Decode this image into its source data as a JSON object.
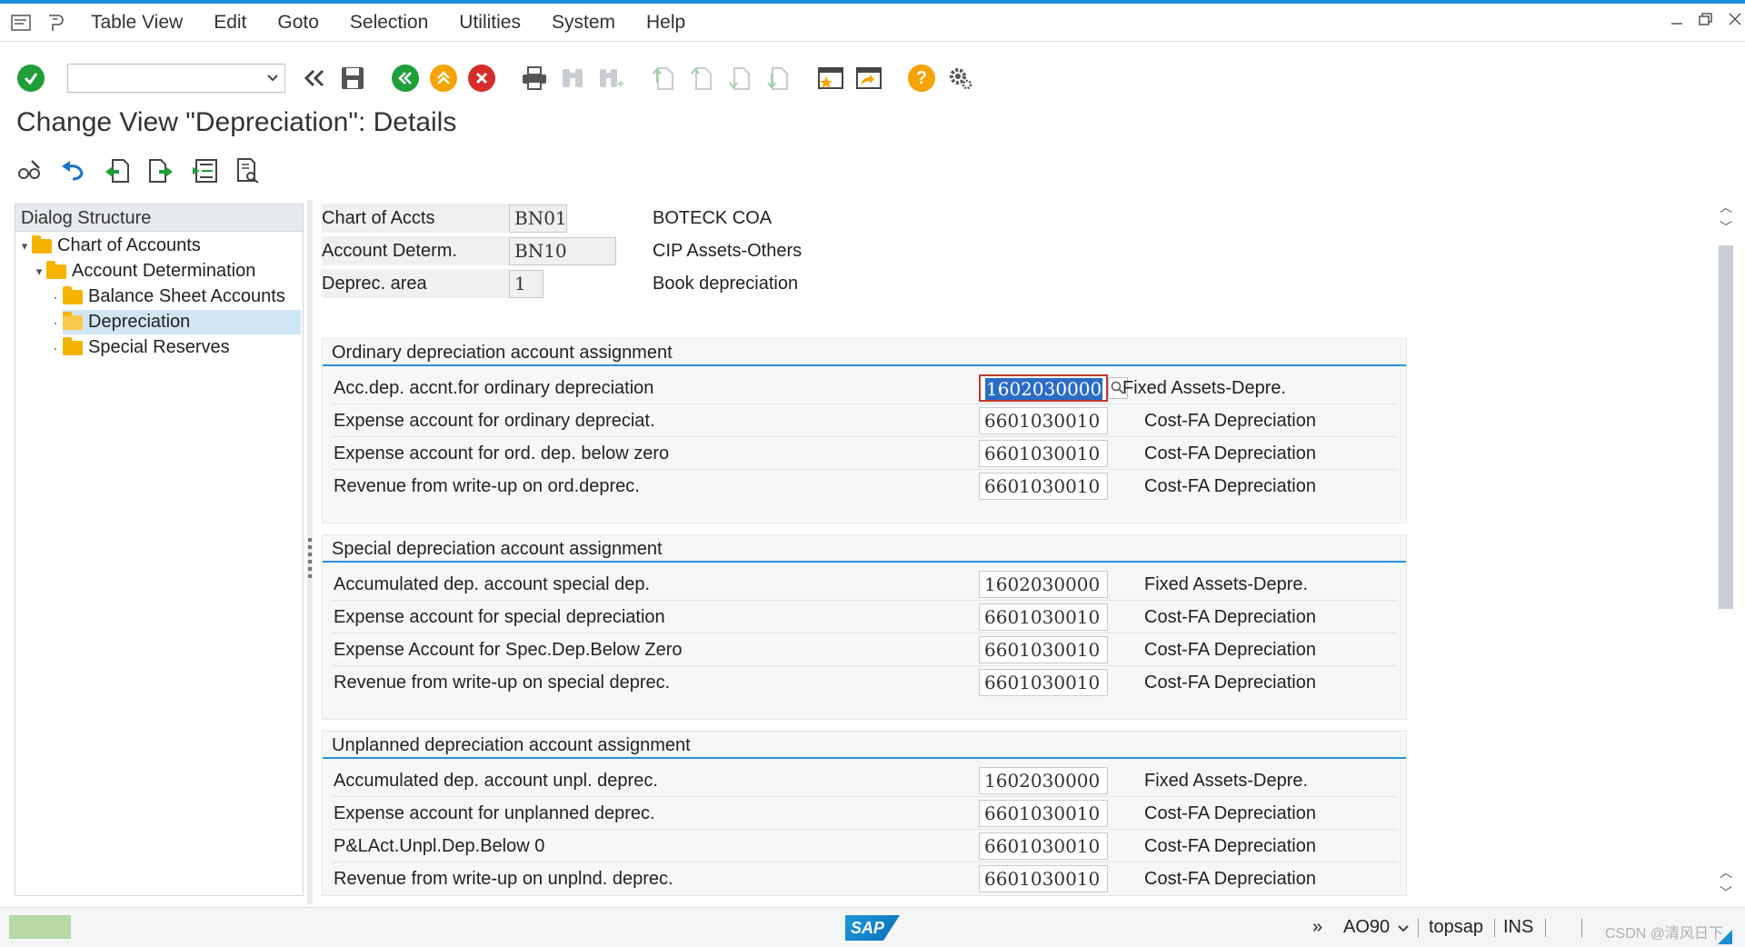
{
  "menu": {
    "items": [
      "Table View",
      "Edit",
      "Goto",
      "Selection",
      "Utilities",
      "System",
      "Help"
    ]
  },
  "toolbar": {
    "command_field_value": ""
  },
  "page_title": "Change View \"Depreciation\": Details",
  "dialog_structure": {
    "header": "Dialog Structure",
    "nodes": [
      {
        "label": "Chart of Accounts"
      },
      {
        "label": "Account Determination"
      },
      {
        "label": "Balance Sheet Accounts"
      },
      {
        "label": "Depreciation"
      },
      {
        "label": "Special Reserves"
      }
    ]
  },
  "header_fields": [
    {
      "label": "Chart of Accts",
      "value": "BN01",
      "desc": "BOTECK COA"
    },
    {
      "label": "Account Determ.",
      "value": "BN10",
      "desc": "CIP Assets-Others"
    },
    {
      "label": "Deprec. area",
      "value": "1",
      "desc": "Book depreciation"
    }
  ],
  "sections": [
    {
      "title": "Ordinary depreciation account assignment",
      "rows": [
        {
          "label": "Acc.dep. accnt.for ordinary depreciation",
          "value": "1602030000",
          "desc": "Fixed Assets-Depre."
        },
        {
          "label": "Expense account for ordinary depreciat.",
          "value": "6601030010",
          "desc": "Cost-FA Depreciation"
        },
        {
          "label": "Expense account for ord. dep. below zero",
          "value": "6601030010",
          "desc": "Cost-FA Depreciation"
        },
        {
          "label": "Revenue from write-up on ord.deprec.",
          "value": "6601030010",
          "desc": "Cost-FA Depreciation"
        }
      ]
    },
    {
      "title": "Special depreciation account assignment",
      "rows": [
        {
          "label": "Accumulated dep. account special dep.",
          "value": "1602030000",
          "desc": "Fixed Assets-Depre."
        },
        {
          "label": "Expense account for special depreciation",
          "value": "6601030010",
          "desc": "Cost-FA Depreciation"
        },
        {
          "label": "Expense Account for Spec.Dep.Below Zero",
          "value": "6601030010",
          "desc": "Cost-FA Depreciation"
        },
        {
          "label": "Revenue from write-up on special deprec.",
          "value": "6601030010",
          "desc": "Cost-FA Depreciation"
        }
      ]
    },
    {
      "title": "Unplanned depreciation account assignment",
      "rows": [
        {
          "label": "Accumulated dep. account unpl. deprec.",
          "value": "1602030000",
          "desc": "Fixed Assets-Depre."
        },
        {
          "label": "Expense account for unplanned deprec.",
          "value": "6601030010",
          "desc": "Cost-FA Depreciation"
        },
        {
          "label": "P&LAct.Unpl.Dep.Below 0",
          "value": "6601030010",
          "desc": "Cost-FA Depreciation"
        },
        {
          "label": "Revenue from write-up on unplnd. deprec.",
          "value": "6601030010",
          "desc": "Cost-FA Depreciation"
        }
      ]
    }
  ],
  "status_bar": {
    "expand": "»",
    "transaction": "AO90",
    "server": "topsap",
    "mode": "INS",
    "sap_logo": "SAP",
    "watermark": "CSDN @清风日下"
  },
  "colors": {
    "accent": "#2b8fd6",
    "selected_node": "#d1e6f5",
    "folder": "#f6b400",
    "ok_green": "#1f9e3a",
    "cancel_red": "#d62c2c",
    "help_yellow": "#f5a300"
  }
}
